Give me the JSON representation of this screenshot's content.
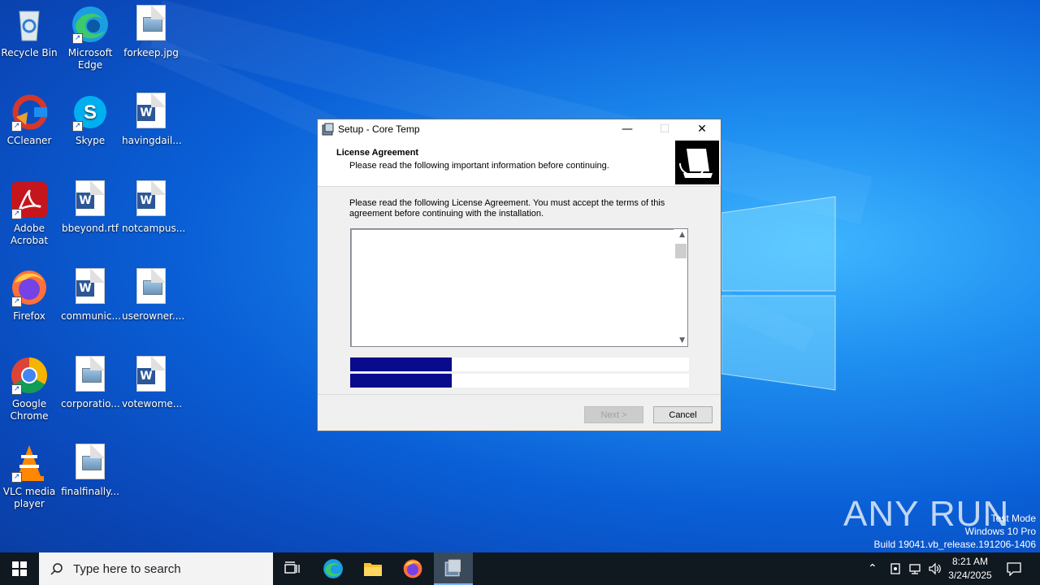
{
  "desktop": {
    "icons": [
      {
        "label": "Recycle Bin"
      },
      {
        "label": "Microsoft Edge"
      },
      {
        "label": "forkeep.jpg"
      },
      {
        "label": "CCleaner"
      },
      {
        "label": "Skype"
      },
      {
        "label": "havingdail..."
      },
      {
        "label": "Adobe Acrobat"
      },
      {
        "label": "bbeyond.rtf"
      },
      {
        "label": "notcampus..."
      },
      {
        "label": "Firefox"
      },
      {
        "label": "communic..."
      },
      {
        "label": "userowner...."
      },
      {
        "label": "Google Chrome"
      },
      {
        "label": "corporatio..."
      },
      {
        "label": "votewome..."
      },
      {
        "label": "VLC media player"
      },
      {
        "label": "finalfinally..."
      }
    ]
  },
  "window": {
    "title": "Setup - Core Temp",
    "header_title": "License Agreement",
    "header_subtitle": "Please read the following important information before continuing.",
    "body_text": "Please read the following License Agreement. You must accept the terms of this agreement before continuing with the installation.",
    "progress": [
      0.3,
      0.3
    ],
    "next_label": "Next >",
    "cancel_label": "Cancel"
  },
  "taskbar": {
    "search_placeholder": "Type here to search",
    "time": "8:21 AM",
    "date": "3/24/2025"
  },
  "watermark": {
    "brand": "ANY RUN",
    "line1": "Test Mode",
    "line2": "Windows 10 Pro",
    "line3": "Build 19041.vb_release.191206-1406"
  }
}
